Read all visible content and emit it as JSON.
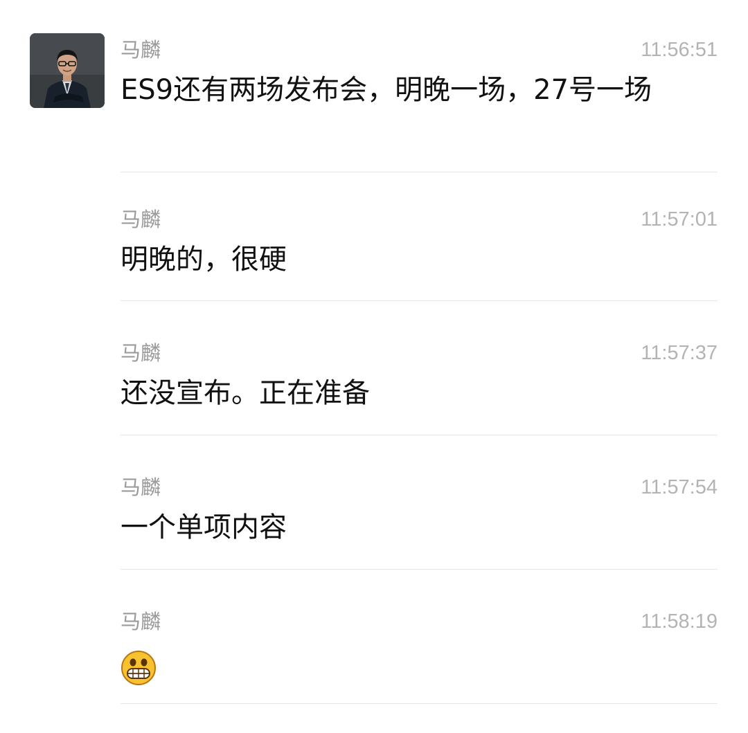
{
  "messages": [
    {
      "sender": "马麟",
      "time": "11:56:51",
      "text": "ES9还有两场发布会，明晚一场，27号一场"
    },
    {
      "sender": "马麟",
      "time": "11:57:01",
      "text": "明晚的，很硬"
    },
    {
      "sender": "马麟",
      "time": "11:57:37",
      "text": "还没宣布。正在准备"
    },
    {
      "sender": "马麟",
      "time": "11:57:54",
      "text": "一个单项内容"
    },
    {
      "sender": "马麟",
      "time": "11:58:19",
      "emoji": "grinning-face-emoji"
    }
  ],
  "colors": {
    "background": "#ffffff",
    "sender_text": "#9a9a9a",
    "time_text": "#b3b3b3",
    "message_text": "#111111",
    "divider": "#e6e6e6"
  }
}
